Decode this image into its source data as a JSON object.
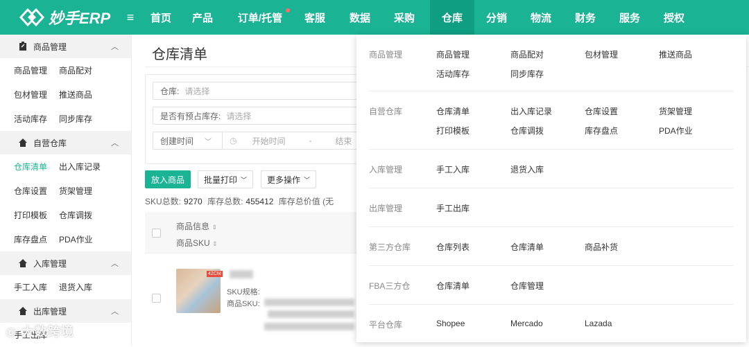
{
  "app": {
    "logo_text": "妙手ERP",
    "menu_icon": "hamburger-icon"
  },
  "nav": [
    {
      "label": "首页"
    },
    {
      "label": "产品"
    },
    {
      "label": "订单/托管"
    },
    {
      "label": "客服"
    },
    {
      "label": "数据"
    },
    {
      "label": "采购"
    },
    {
      "label": "仓库"
    },
    {
      "label": "分销"
    },
    {
      "label": "物流"
    },
    {
      "label": "财务"
    },
    {
      "label": "服务"
    },
    {
      "label": "授权"
    }
  ],
  "sidebar": {
    "groups": [
      {
        "title": "商品管理",
        "items": [
          [
            "商品管理",
            "商品配对"
          ],
          [
            "包材管理",
            "推送商品"
          ],
          [
            "活动库存",
            "同步库存"
          ]
        ]
      },
      {
        "title": "自营仓库",
        "items": [
          [
            "仓库清单",
            "出入库记录"
          ],
          [
            "仓库设置",
            "货架管理"
          ],
          [
            "打印模板",
            "仓库调拨"
          ],
          [
            "库存盘点",
            "PDA作业"
          ]
        ]
      },
      {
        "title": "入库管理",
        "items": [
          [
            "手工入库",
            "退货入库"
          ]
        ]
      },
      {
        "title": "出库管理",
        "items": [
          [
            "手工出库",
            ""
          ]
        ]
      }
    ]
  },
  "main": {
    "title": "仓库清单",
    "filters": {
      "warehouse_label": "仓库:",
      "warehouse_placeholder": "请选择",
      "presale_label": "是否有预占库存:",
      "presale_placeholder": "请选择",
      "date_type": "创建时间",
      "start_placeholder": "开始时间",
      "range_sep": "-",
      "end_placeholder": "结束"
    },
    "buttons": {
      "add": "放入商品",
      "batch_print": "批量打印",
      "more": "更多操作"
    },
    "stats": {
      "sku_label": "SKU总数:",
      "sku_value": "9270",
      "stock_label": "库存总数:",
      "stock_value": "455412",
      "value_label": "库存总价值 (无"
    },
    "table": {
      "col1": "商品信息",
      "col2": "商品SKU"
    },
    "product": {
      "spec_label": "SKU规格:",
      "sku_label": "商品SKU:",
      "img_tag": "42CM"
    }
  },
  "dropdown": {
    "rows": [
      {
        "category": "商品管理",
        "links": [
          [
            "商品管理",
            "商品配对",
            "包材管理",
            "推送商品"
          ],
          [
            "活动库存",
            "同步库存"
          ]
        ]
      },
      {
        "category": "自营仓库",
        "links": [
          [
            "仓库清单",
            "出入库记录",
            "仓库设置",
            "货架管理"
          ],
          [
            "打印模板",
            "仓库调拨",
            "库存盘点",
            "PDA作业"
          ]
        ]
      },
      {
        "category": "入库管理",
        "links": [
          [
            "手工入库",
            "退货入库"
          ]
        ]
      },
      {
        "category": "出库管理",
        "links": [
          [
            "手工出库"
          ]
        ]
      },
      {
        "category": "第三方仓库",
        "links": [
          [
            "仓库列表",
            "仓库清单",
            "商品补货"
          ]
        ]
      },
      {
        "category": "FBA三方仓",
        "links": [
          [
            "仓库清单",
            "仓库管理"
          ]
        ]
      },
      {
        "category": "平台仓库",
        "links": [
          [
            "Shopee",
            "Mercado",
            "Lazada"
          ]
        ]
      }
    ]
  },
  "watermark": "大数跨境",
  "colors": {
    "brand": "#1ab394",
    "nav_active": "#0f9e82"
  }
}
